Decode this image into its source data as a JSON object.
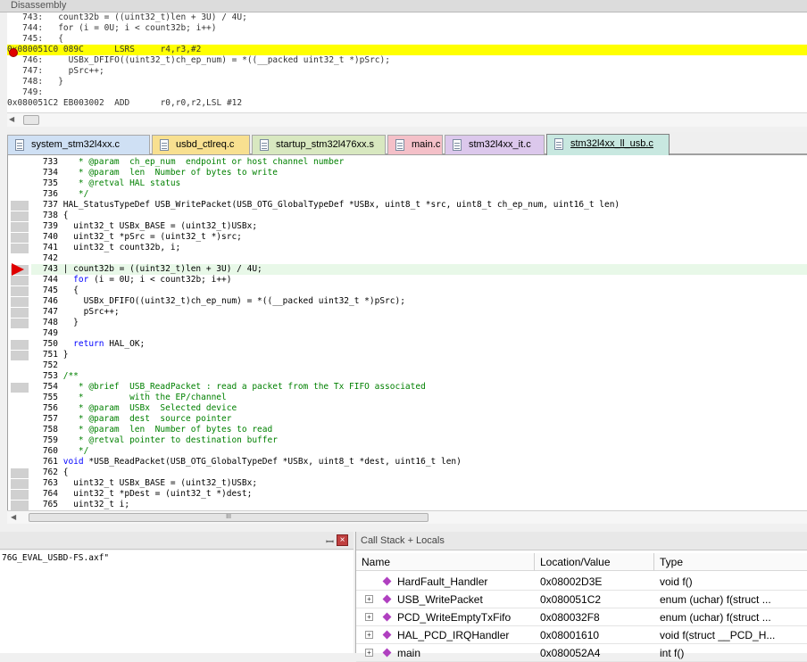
{
  "disassembly": {
    "title": "Disassembly",
    "lines": [
      "   743:   count32b = ((uint32_t)len + 3U) / 4U;",
      "   744:   for (i = 0U; i < count32b; i++)",
      "   745:   {",
      "0x080051C0 089C      LSRS     r4,r3,#2",
      "   746:     USBx_DFIFO((uint32_t)ch_ep_num) = *((__packed uint32_t *)pSrc);",
      "   747:     pSrc++;",
      "   748:   }",
      "   749:",
      "0x080051C2 EB003002  ADD      r0,r0,r2,LSL #12"
    ]
  },
  "tabs": [
    {
      "label": "system_stm32l4xx.c",
      "color": "#cfe0f4",
      "active": false
    },
    {
      "label": "usbd_ctlreq.c",
      "color": "#f8e090",
      "active": false
    },
    {
      "label": "startup_stm32l476xx.s",
      "color": "#d8e8c0",
      "active": false
    },
    {
      "label": "main.c",
      "color": "#f4c0c8",
      "active": false
    },
    {
      "label": "stm32l4xx_it.c",
      "color": "#dcc8ec",
      "active": false
    },
    {
      "label": "stm32l4xx_ll_usb.c",
      "color": "#c8e8e0",
      "active": true
    }
  ],
  "editor": {
    "lines": [
      {
        "n": "733",
        "t": "    * @param  ch_ep_num  endpoint or host channel number",
        "k": "cmt"
      },
      {
        "n": "734",
        "t": "    * @param  len  Number of bytes to write",
        "k": "cmt"
      },
      {
        "n": "735",
        "t": "    * @retval HAL status",
        "k": "cmt"
      },
      {
        "n": "736",
        "t": "    */",
        "k": "cmt"
      },
      {
        "n": "737",
        "t": " HAL_StatusTypeDef USB_WritePacket(USB_OTG_GlobalTypeDef *USBx, uint8_t *src, uint8_t ch_ep_num, uint16_t len)",
        "k": ""
      },
      {
        "n": "738",
        "t": " {",
        "k": ""
      },
      {
        "n": "739",
        "t": "   uint32_t USBx_BASE = (uint32_t)USBx;",
        "k": ""
      },
      {
        "n": "740",
        "t": "   uint32_t *pSrc = (uint32_t *)src;",
        "k": ""
      },
      {
        "n": "741",
        "t": "   uint32_t count32b, i;",
        "k": ""
      },
      {
        "n": "742",
        "t": "",
        "k": ""
      },
      {
        "n": "743",
        "t": " | count32b = ((uint32_t)len + 3U) / 4U;",
        "k": "cur"
      },
      {
        "n": "744",
        "t": "   for (i = 0U; i < count32b; i++)",
        "k": "kw"
      },
      {
        "n": "745",
        "t": "   {",
        "k": ""
      },
      {
        "n": "746",
        "t": "     USBx_DFIFO((uint32_t)ch_ep_num) = *((__packed uint32_t *)pSrc);",
        "k": ""
      },
      {
        "n": "747",
        "t": "     pSrc++;",
        "k": ""
      },
      {
        "n": "748",
        "t": "   }",
        "k": ""
      },
      {
        "n": "749",
        "t": "",
        "k": ""
      },
      {
        "n": "750",
        "t": "   return HAL_OK;",
        "k": "kw"
      },
      {
        "n": "751",
        "t": " }",
        "k": ""
      },
      {
        "n": "752",
        "t": "",
        "k": ""
      },
      {
        "n": "753",
        "t": " /**",
        "k": "cmt"
      },
      {
        "n": "754",
        "t": "    * @brief  USB_ReadPacket : read a packet from the Tx FIFO associated",
        "k": "cmt"
      },
      {
        "n": "755",
        "t": "    *         with the EP/channel",
        "k": "cmt"
      },
      {
        "n": "756",
        "t": "    * @param  USBx  Selected device",
        "k": "cmt"
      },
      {
        "n": "757",
        "t": "    * @param  dest  source pointer",
        "k": "cmt"
      },
      {
        "n": "758",
        "t": "    * @param  len  Number of bytes to read",
        "k": "cmt"
      },
      {
        "n": "759",
        "t": "    * @retval pointer to destination buffer",
        "k": "cmt"
      },
      {
        "n": "760",
        "t": "    */",
        "k": "cmt"
      },
      {
        "n": "761",
        "t": " void *USB_ReadPacket(USB_OTG_GlobalTypeDef *USBx, uint8_t *dest, uint16_t len)",
        "k": "kw"
      },
      {
        "n": "762",
        "t": " {",
        "k": ""
      },
      {
        "n": "763",
        "t": "   uint32_t USBx_BASE = (uint32_t)USBx;",
        "k": ""
      },
      {
        "n": "764",
        "t": "   uint32_t *pDest = (uint32_t *)dest;",
        "k": ""
      },
      {
        "n": "765",
        "t": "   uint32_t i;",
        "k": ""
      }
    ],
    "scroll_thumb_label": "III"
  },
  "output_panel": {
    "text": "76G_EVAL_USBD-FS.axf\"",
    "pin_label": "ꟷ",
    "close_label": "×"
  },
  "callstack": {
    "title": "Call Stack + Locals",
    "columns": [
      "Name",
      "Location/Value",
      "Type"
    ],
    "rows": [
      {
        "name": "HardFault_Handler",
        "loc": "0x08002D3E",
        "type": "void f()",
        "expandable": false
      },
      {
        "name": "USB_WritePacket",
        "loc": "0x080051C2",
        "type": "enum (uchar) f(struct ...",
        "expandable": true
      },
      {
        "name": "PCD_WriteEmptyTxFifo",
        "loc": "0x080032F8",
        "type": "enum (uchar) f(struct ...",
        "expandable": true
      },
      {
        "name": "HAL_PCD_IRQHandler",
        "loc": "0x08001610",
        "type": "void f(struct __PCD_H...",
        "expandable": true
      },
      {
        "name": "main",
        "loc": "0x080052A4",
        "type": "int f()",
        "expandable": true
      }
    ]
  }
}
